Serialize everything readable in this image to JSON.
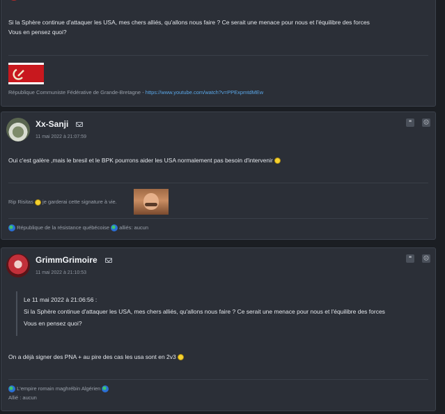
{
  "post1": {
    "message_line1": "Si la Sphère continue d'attaquer les USA, mes chers alliés, qu'allons nous faire ? Ce serait une menace pour nous et l'équilibre des forces",
    "message_line2": "Vous en pensez quoi?",
    "signature_text": "République Communiste Fédérative de Grande-Bretagne - ",
    "signature_link": "https://www.youtube.com/watch?v=PPExpmtdMEw"
  },
  "post2": {
    "username": "Xx-Sanji",
    "date": "11 mai 2022 à 21:07:59",
    "message": "Oui c'est galère ,mais le bresil et le BPK pourrons aider les USA normalement pas besoin d'intervenir",
    "sig_line_start": "Rip Risitas",
    "sig_line_end": "je garderai cette signature à vie.",
    "footer_nation": "République de la résistance québécoise",
    "footer_allies": "alliés: aucun"
  },
  "post3": {
    "username": "GrimmGrimoire",
    "date": "11 mai 2022 à 21:10:53",
    "quote_header": "Le 11 mai 2022 à 21:06:56 :",
    "quote_line1": "Si la Sphère continue d'attaquer les USA, mes chers alliés, qu'allons nous faire ? Ce serait une menace pour nous et l'équilibre des forces",
    "quote_line2": "Vous en pensez quoi?",
    "message": "On a déjà signer des PNA + au pire des cas les usa sont en 2v3",
    "footer_nation": "L'empire romain maghrébin Algérien",
    "footer_allies": "Allié : aucun"
  },
  "icons": [
    "envelope-icon",
    "quote-icon",
    "report-icon",
    "globe-icon",
    "smiley-icon"
  ],
  "colors": {
    "background": "#1b1e23",
    "card": "#2b2f37",
    "link": "#5aa7e8"
  }
}
